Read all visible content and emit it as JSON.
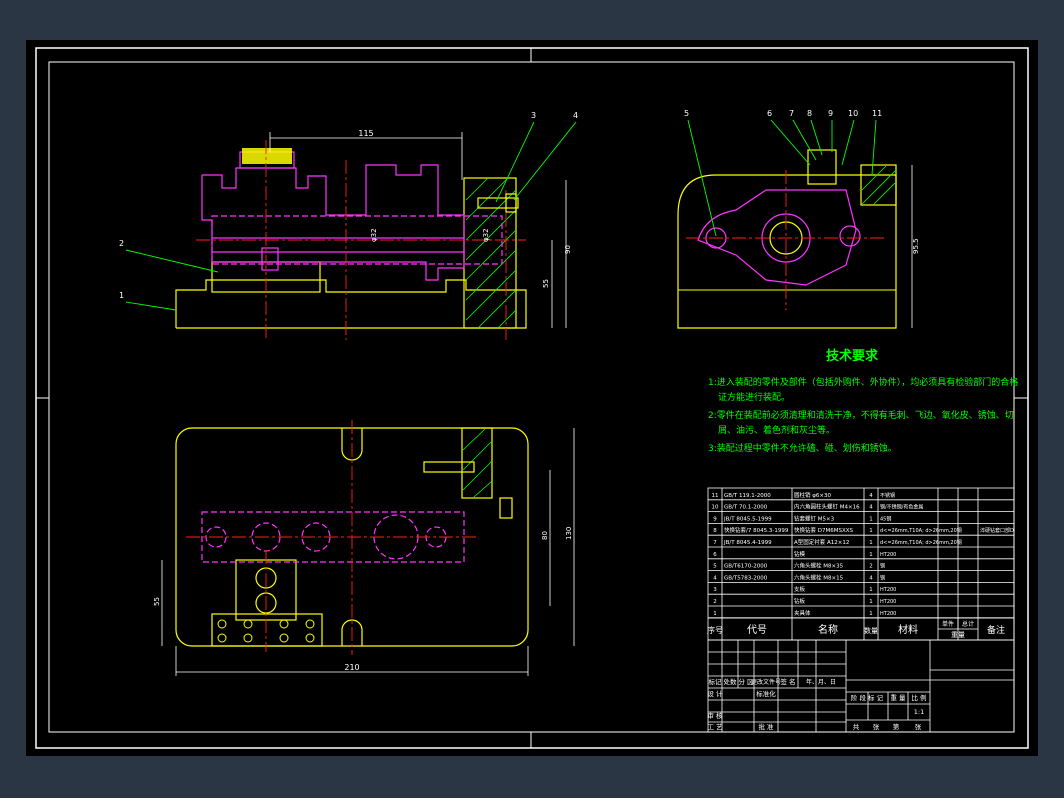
{
  "tech": {
    "title": "技术要求",
    "line1": "1:进入装配的零件及部件（包括外购件、外协件），均必须具有检验部门的合格",
    "line2": "证方能进行装配。",
    "line3": "2:零件在装配前必须清理和清洗干净，不得有毛刺、飞边、氧化皮、锈蚀、切",
    "line4": "屑、油污、着色剂和灰尘等。",
    "line5": "3:装配过程中零件不允许磕、碰、划伤和锈蚀。"
  },
  "dims": {
    "top_width": "115",
    "phi_a": "φ32",
    "phi_b": "φ32",
    "h90": "90",
    "h55": "55",
    "h95": "95.5",
    "plan_width": "210",
    "plan_height": "130",
    "plan_inner": "80",
    "plan_left": "55"
  },
  "balloons": {
    "b1": "1",
    "b2": "2",
    "b3": "3",
    "b4": "4",
    "b5": "5",
    "b6": "6",
    "b7": "7",
    "b8": "8",
    "b9": "9",
    "b10": "10",
    "b11": "11"
  },
  "bom": {
    "rows": [
      {
        "no": "11",
        "code": "GB/T 119.1-2000",
        "name": "圆柱销  φ6×30",
        "qty": "4",
        "mat": "不锈钢",
        "note": ""
      },
      {
        "no": "10",
        "code": "GB/T 70.1-2000",
        "name": "内六角圆柱头螺钉 M4×16",
        "qty": "4",
        "mat": "钢/不锈钢/有色金属",
        "note": ""
      },
      {
        "no": "9",
        "code": "JB/T 8045.5-1999",
        "name": "钻套螺钉 M5×3",
        "qty": "1",
        "mat": "45钢",
        "note": ""
      },
      {
        "no": "8",
        "code": "快换钻套/7 8045.3-1999",
        "name": "快换钻套 D7M6MSXXS",
        "qty": "1",
        "mat": "d<=26mm,T10A; d>26mm,20钢",
        "note": "淬硬钻套口部D"
      },
      {
        "no": "7",
        "code": "JB/T 8045.4-1999",
        "name": "A型固定衬套 A12×12",
        "qty": "1",
        "mat": "d<=26mm,T10A; d>26mm,20钢",
        "note": ""
      },
      {
        "no": "6",
        "code": "",
        "name": "钻模",
        "qty": "1",
        "mat": "HT200",
        "note": ""
      },
      {
        "no": "5",
        "code": "GB/T6170-2000",
        "name": "六角头螺栓 M8×35",
        "qty": "2",
        "mat": "钢",
        "note": ""
      },
      {
        "no": "4",
        "code": "GB/T5783-2000",
        "name": "六角头螺栓 M8×15",
        "qty": "4",
        "mat": "钢",
        "note": ""
      },
      {
        "no": "3",
        "code": "",
        "name": "支板",
        "qty": "1",
        "mat": "HT200",
        "note": ""
      },
      {
        "no": "2",
        "code": "",
        "name": "钻板",
        "qty": "1",
        "mat": "HT200",
        "note": ""
      },
      {
        "no": "1",
        "code": "",
        "name": "夹具体",
        "qty": "1",
        "mat": "HT200",
        "note": ""
      }
    ],
    "hdr_no": "序号",
    "hdr_code": "代号",
    "hdr_name": "名称",
    "hdr_qty": "数量",
    "hdr_mat": "材料",
    "hdr_w1": "单件",
    "hdr_w2": "总计",
    "hdr_wt": "重量",
    "hdr_note": "备注"
  },
  "title_block": {
    "biaoji": "标记",
    "chushu": "处数",
    "fenqu": "分 区",
    "gengai": "更改文件号",
    "qianming": "签 名",
    "nyr": "年、月、日",
    "sheji": "设 计",
    "biaozhunhua": "标准化",
    "jieduan": "阶 段 标 记",
    "zhongliang": "重 量",
    "bili": "比 例",
    "scale": "1:1",
    "shenhe": "审 核",
    "gongyi": "工 艺",
    "pizhun": "批 准",
    "gong": "共",
    "zhang1": "张",
    "di": "第",
    "zhang2": "张"
  }
}
